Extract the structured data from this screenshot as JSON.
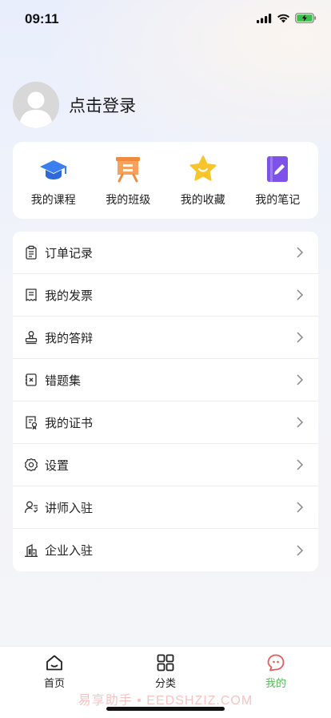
{
  "status_bar": {
    "time": "09:11"
  },
  "profile": {
    "login_text": "点击登录"
  },
  "quick_actions": [
    {
      "label": "我的课程",
      "icon": "graduation-cap-icon",
      "color": "#3a7ef0"
    },
    {
      "label": "我的班级",
      "icon": "presentation-board-icon",
      "color": "#f08a3c"
    },
    {
      "label": "我的收藏",
      "icon": "star-icon",
      "color": "#f7c52a"
    },
    {
      "label": "我的笔记",
      "icon": "notebook-pen-icon",
      "color": "#7e52e8"
    }
  ],
  "menu": [
    {
      "label": "订单记录",
      "icon": "clipboard-icon"
    },
    {
      "label": "我的发票",
      "icon": "invoice-icon"
    },
    {
      "label": "我的答辩",
      "icon": "stamp-icon"
    },
    {
      "label": "错题集",
      "icon": "error-book-icon"
    },
    {
      "label": "我的证书",
      "icon": "certificate-icon"
    },
    {
      "label": "设置",
      "icon": "gear-icon"
    },
    {
      "label": "讲师入驻",
      "icon": "lecturer-icon"
    },
    {
      "label": "企业入驻",
      "icon": "building-icon"
    }
  ],
  "tabs": [
    {
      "label": "首页",
      "icon": "home-icon",
      "active": false
    },
    {
      "label": "分类",
      "icon": "grid-icon",
      "active": false
    },
    {
      "label": "我的",
      "icon": "chat-bubble-icon",
      "active": true
    }
  ],
  "watermark": "易享助手 • EEDSHZIZ.COM",
  "colors": {
    "active_tab": "#59b95f",
    "background": "#f4f5f8"
  }
}
